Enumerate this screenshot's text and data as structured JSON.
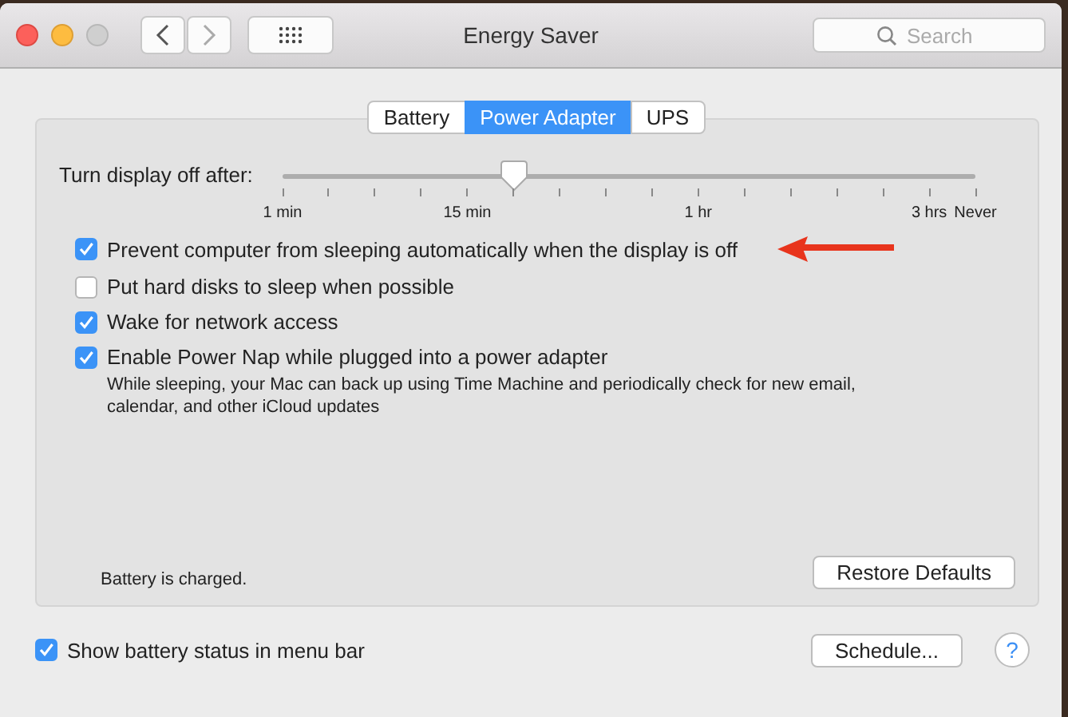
{
  "window": {
    "title": "Energy Saver",
    "search": {
      "placeholder": "Search"
    }
  },
  "tabs": [
    {
      "label": "Battery",
      "selected": false
    },
    {
      "label": "Power Adapter",
      "selected": true
    },
    {
      "label": "UPS",
      "selected": false
    }
  ],
  "slider": {
    "label": "Turn display off after:",
    "level": 0.333,
    "ticks": [
      {
        "kind": "labeled",
        "label": "1 min"
      },
      {
        "kind": "plain"
      },
      {
        "kind": "plain"
      },
      {
        "kind": "plain"
      },
      {
        "kind": "labeled",
        "label": "15 min"
      },
      {
        "kind": "plain"
      },
      {
        "kind": "plain"
      },
      {
        "kind": "plain"
      },
      {
        "kind": "plain"
      },
      {
        "kind": "labeled",
        "label": "1 hr"
      },
      {
        "kind": "plain"
      },
      {
        "kind": "plain"
      },
      {
        "kind": "plain"
      },
      {
        "kind": "plain"
      },
      {
        "kind": "labeled",
        "label": "3 hrs"
      },
      {
        "kind": "labeled",
        "label": "Never"
      }
    ]
  },
  "options": [
    {
      "label": "Prevent computer from sleeping automatically when the display is off",
      "checked": true,
      "highlighted": true
    },
    {
      "label": "Put hard disks to sleep when possible",
      "checked": false
    },
    {
      "label": "Wake for network access",
      "checked": true
    },
    {
      "label": "Enable Power Nap while plugged into a power adapter",
      "checked": true,
      "note": "While sleeping, your Mac can back up using Time Machine and periodically check for new email, calendar, and other iCloud updates"
    }
  ],
  "status": "Battery is charged.",
  "restore_button": "Restore Defaults",
  "footer": {
    "option": {
      "label": "Show battery status in menu bar",
      "checked": true
    },
    "schedule_button": "Schedule...",
    "help": "?"
  }
}
